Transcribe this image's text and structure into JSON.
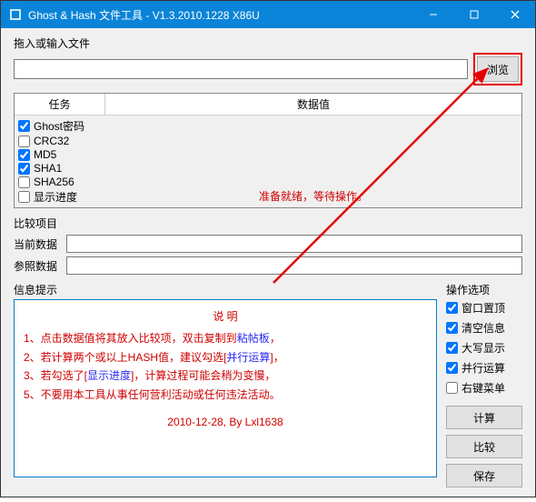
{
  "window": {
    "title": "Ghost & Hash 文件工具 - V1.3.2010.1228 X86U"
  },
  "input_section": {
    "label": "拖入或输入文件",
    "value": "",
    "browse_label": "浏览"
  },
  "task_panel": {
    "header_task": "任务",
    "header_value": "数据值",
    "tasks": [
      {
        "label": "Ghost密码",
        "checked": true
      },
      {
        "label": "CRC32",
        "checked": false
      },
      {
        "label": "MD5",
        "checked": true
      },
      {
        "label": "SHA1",
        "checked": true
      },
      {
        "label": "SHA256",
        "checked": false
      },
      {
        "label": "显示进度",
        "checked": false
      }
    ],
    "status": "准备就绪，等待操作。"
  },
  "compare": {
    "section_label": "比较项目",
    "current_label": "当前数据",
    "current_value": "",
    "reference_label": "参照数据",
    "reference_value": ""
  },
  "info": {
    "section_label": "信息提示",
    "heading": "说  明",
    "line1_pre": "1、点击数据值将其放入比较项，双击复制到",
    "line1_blue": "粘帖板",
    "line1_post": "，",
    "line2_pre": "2、若计算两个或以上HASH值，建议勾选[",
    "line2_blue": "并行运算",
    "line2_post": "]，",
    "line3_pre": "3、若勾选了[",
    "line3_blue": "显示进度",
    "line3_post": "]，计算过程可能会稍为变慢，",
    "line5": "5、不要用本工具从事任何营利活动或任何违法活动。",
    "footer": "2010-12-28,  By Lxl1638"
  },
  "options": {
    "section_label": "操作选项",
    "items": [
      {
        "label": "窗口置顶",
        "checked": true
      },
      {
        "label": "清空信息",
        "checked": true
      },
      {
        "label": "大写显示",
        "checked": true
      },
      {
        "label": "并行运算",
        "checked": true
      },
      {
        "label": "右键菜单",
        "checked": false
      }
    ]
  },
  "actions": {
    "calc": "计算",
    "compare": "比较",
    "save": "保存"
  }
}
